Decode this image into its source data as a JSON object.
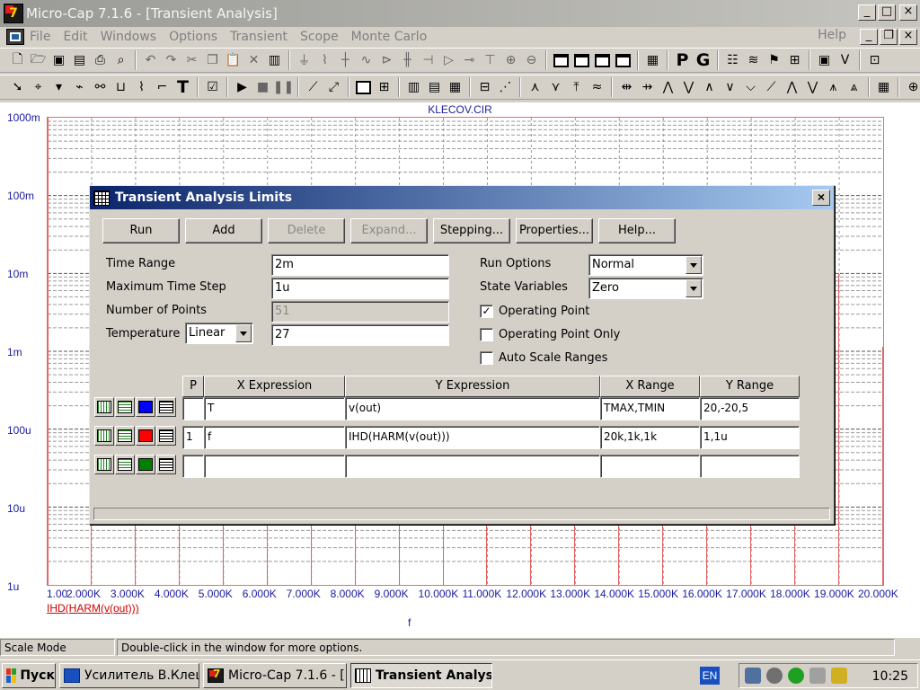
{
  "window": {
    "title": "Micro-Cap 7.1.6 - [Transient Analysis]",
    "logo_text": "7",
    "controls": [
      "_",
      "□",
      "×"
    ],
    "mdi_controls": [
      "_",
      "❐",
      "×"
    ]
  },
  "menu": {
    "items": [
      "File",
      "Edit",
      "Windows",
      "Options",
      "Transient",
      "Scope",
      "Monte Carlo"
    ],
    "help": "Help"
  },
  "toolbar1": {
    "icons": [
      "new-icon",
      "open-icon",
      "save-icon",
      "save-as-icon",
      "print-icon",
      "print-preview-icon",
      "undo-icon",
      "redo-icon",
      "cut-icon",
      "copy-icon",
      "paste-icon",
      "clear-icon",
      "select-all-icon",
      "ground-icon",
      "resistor-icon",
      "wire-icon",
      "inductor-icon",
      "diode-icon",
      "capacitor-icon",
      "transistor-icon",
      "opamp-icon",
      "battery-icon",
      "source-icon",
      "current-source-icon",
      "split-horizontal-icon",
      "split-vertical-icon",
      "window-icon",
      "tile-icon",
      "calculator-icon",
      "p-icon",
      "g-icon",
      "parts-icon",
      "waveform-icon",
      "measure-icon",
      "component-icon",
      "vds-icon",
      "preview-icon"
    ],
    "p_label": "P",
    "g_label": "G"
  },
  "plot": {
    "file": "KLECOV.CIR",
    "y_labels": [
      "1000m",
      "100m",
      "10m",
      "1m",
      "100u",
      "10u",
      "1u"
    ],
    "x_labels": [
      "1.00",
      "2.000K",
      "3.000K",
      "4.000K",
      "5.000K",
      "6.000K",
      "7.000K",
      "8.000K",
      "9.000K",
      "10.000K",
      "11.000K",
      "12.000K",
      "13.000K",
      "14.000K",
      "15.000K",
      "16.000K",
      "17.000K",
      "18.000K",
      "19.000K",
      "20.000K"
    ],
    "x_expr": "IHD(HARM(v(out)))",
    "x_var": "f"
  },
  "dialog": {
    "title": "Transient Analysis Limits",
    "close": "×",
    "buttons": {
      "run": "Run",
      "add": "Add",
      "delete": "Delete",
      "expand": "Expand...",
      "stepping": "Stepping...",
      "properties": "Properties...",
      "help": "Help..."
    },
    "labels": {
      "time_range": "Time Range",
      "max_step": "Maximum Time Step",
      "num_points": "Number of Points",
      "temperature": "Temperature",
      "run_options": "Run Options",
      "state_variables": "State Variables",
      "operating_point": "Operating Point",
      "operating_point_only": "Operating Point Only",
      "auto_scale": "Auto Scale Ranges"
    },
    "values": {
      "time_range": "2m",
      "max_step": "1u",
      "num_points": "51",
      "temperature_mode": "Linear",
      "temperature": "27",
      "run_options": "Normal",
      "state_variables": "Zero",
      "operating_point_check": "✓",
      "operating_point_only_check": "",
      "auto_scale_check": ""
    },
    "table": {
      "headers": {
        "p": "P",
        "x_expr": "X Expression",
        "y_expr": "Y Expression",
        "x_range": "X Range",
        "y_range": "Y Range"
      },
      "rows": [
        {
          "color": "#0000ff",
          "p": "",
          "x": "T",
          "y": "v(out)",
          "xr": "TMAX,TMIN",
          "yr": "20,-20,5"
        },
        {
          "color": "#ff0000",
          "p": "1",
          "x": "f",
          "y": "IHD(HARM(v(out)))",
          "xr": "20k,1k,1k",
          "yr": "1,1u"
        },
        {
          "color": "#008000",
          "p": "",
          "x": "",
          "y": "",
          "xr": "",
          "yr": ""
        }
      ]
    }
  },
  "statusbar": {
    "mode": "Scale Mode",
    "hint": "Double-click in the window for more options."
  },
  "taskbar": {
    "start": "Пуск",
    "tasks": [
      "Усилитель В.Клец...",
      "Micro-Cap 7.1.6 - [...",
      "Transient Analys..."
    ],
    "lang": "EN",
    "time": "10:25"
  }
}
